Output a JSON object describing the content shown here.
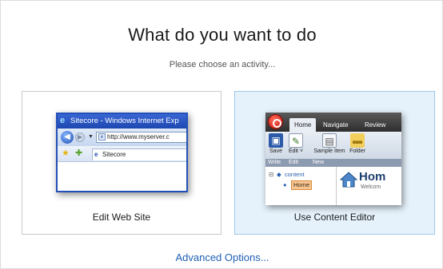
{
  "dialog": {
    "title": "What do you want to do",
    "subtitle": "Please choose an activity..."
  },
  "options": [
    {
      "label": "Edit Web Site",
      "thumbnail": {
        "window_title": "Sitecore - Windows Internet Exp",
        "address": "http://www.myserver.c",
        "tab": "Sitecore"
      }
    },
    {
      "label": "Use Content Editor",
      "selected": true,
      "thumbnail": {
        "tabs": [
          "Home",
          "Navigate",
          "Review"
        ],
        "buttons": [
          "Save",
          "Edit",
          "Sample Item",
          "Folder"
        ],
        "edit_arrow": "˅",
        "groups": [
          "Write",
          "Edit",
          "New"
        ],
        "tree_root": "content",
        "tree_selected": "Home",
        "preview_title": "Hom",
        "preview_subtitle": "Welcom"
      }
    }
  ],
  "advanced_link": "Advanced Options...",
  "colors": {
    "link": "#1f5fb5",
    "selected_card_bg": "#e6f2fb",
    "selected_card_border": "#9fc7e8"
  }
}
